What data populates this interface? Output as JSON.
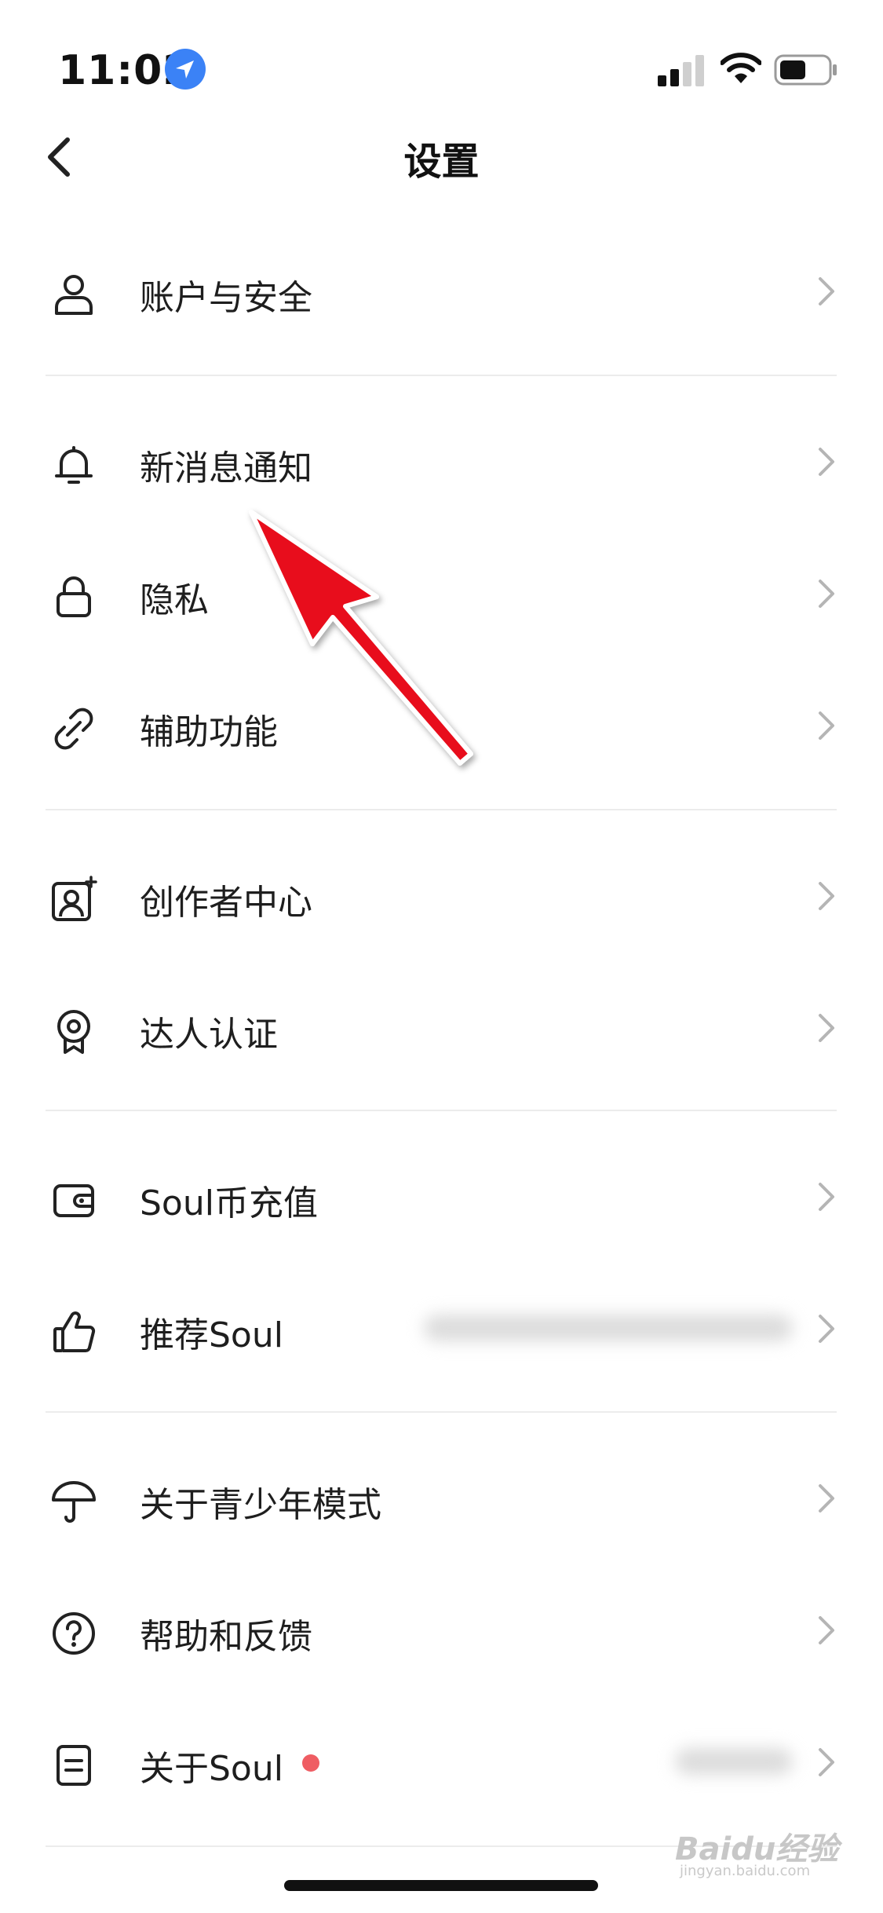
{
  "status_bar": {
    "time": "11:02"
  },
  "nav": {
    "title": "设置"
  },
  "rows": [
    {
      "label": "账户与安全",
      "icon": "person-icon"
    },
    {
      "label": "新消息通知",
      "icon": "bell-icon"
    },
    {
      "label": "隐私",
      "icon": "lock-icon"
    },
    {
      "label": "辅助功能",
      "icon": "link-icon"
    },
    {
      "label": "创作者中心",
      "icon": "creator-icon"
    },
    {
      "label": "达人认证",
      "icon": "badge-icon"
    },
    {
      "label": "Soul币充值",
      "icon": "wallet-icon"
    },
    {
      "label": "推荐Soul",
      "icon": "thumbs-up-icon"
    },
    {
      "label": "关于青少年模式",
      "icon": "umbrella-icon"
    },
    {
      "label": "帮助和反馈",
      "icon": "help-icon"
    },
    {
      "label": "关于Soul",
      "icon": "document-icon"
    }
  ],
  "watermark": {
    "text": "Baidu经验",
    "sub": "jingyan.baidu.com"
  },
  "colors": {
    "accent_location": "#3b82f6",
    "annotation_arrow": "#e8101a",
    "badge_dot": "#ef5d63"
  }
}
